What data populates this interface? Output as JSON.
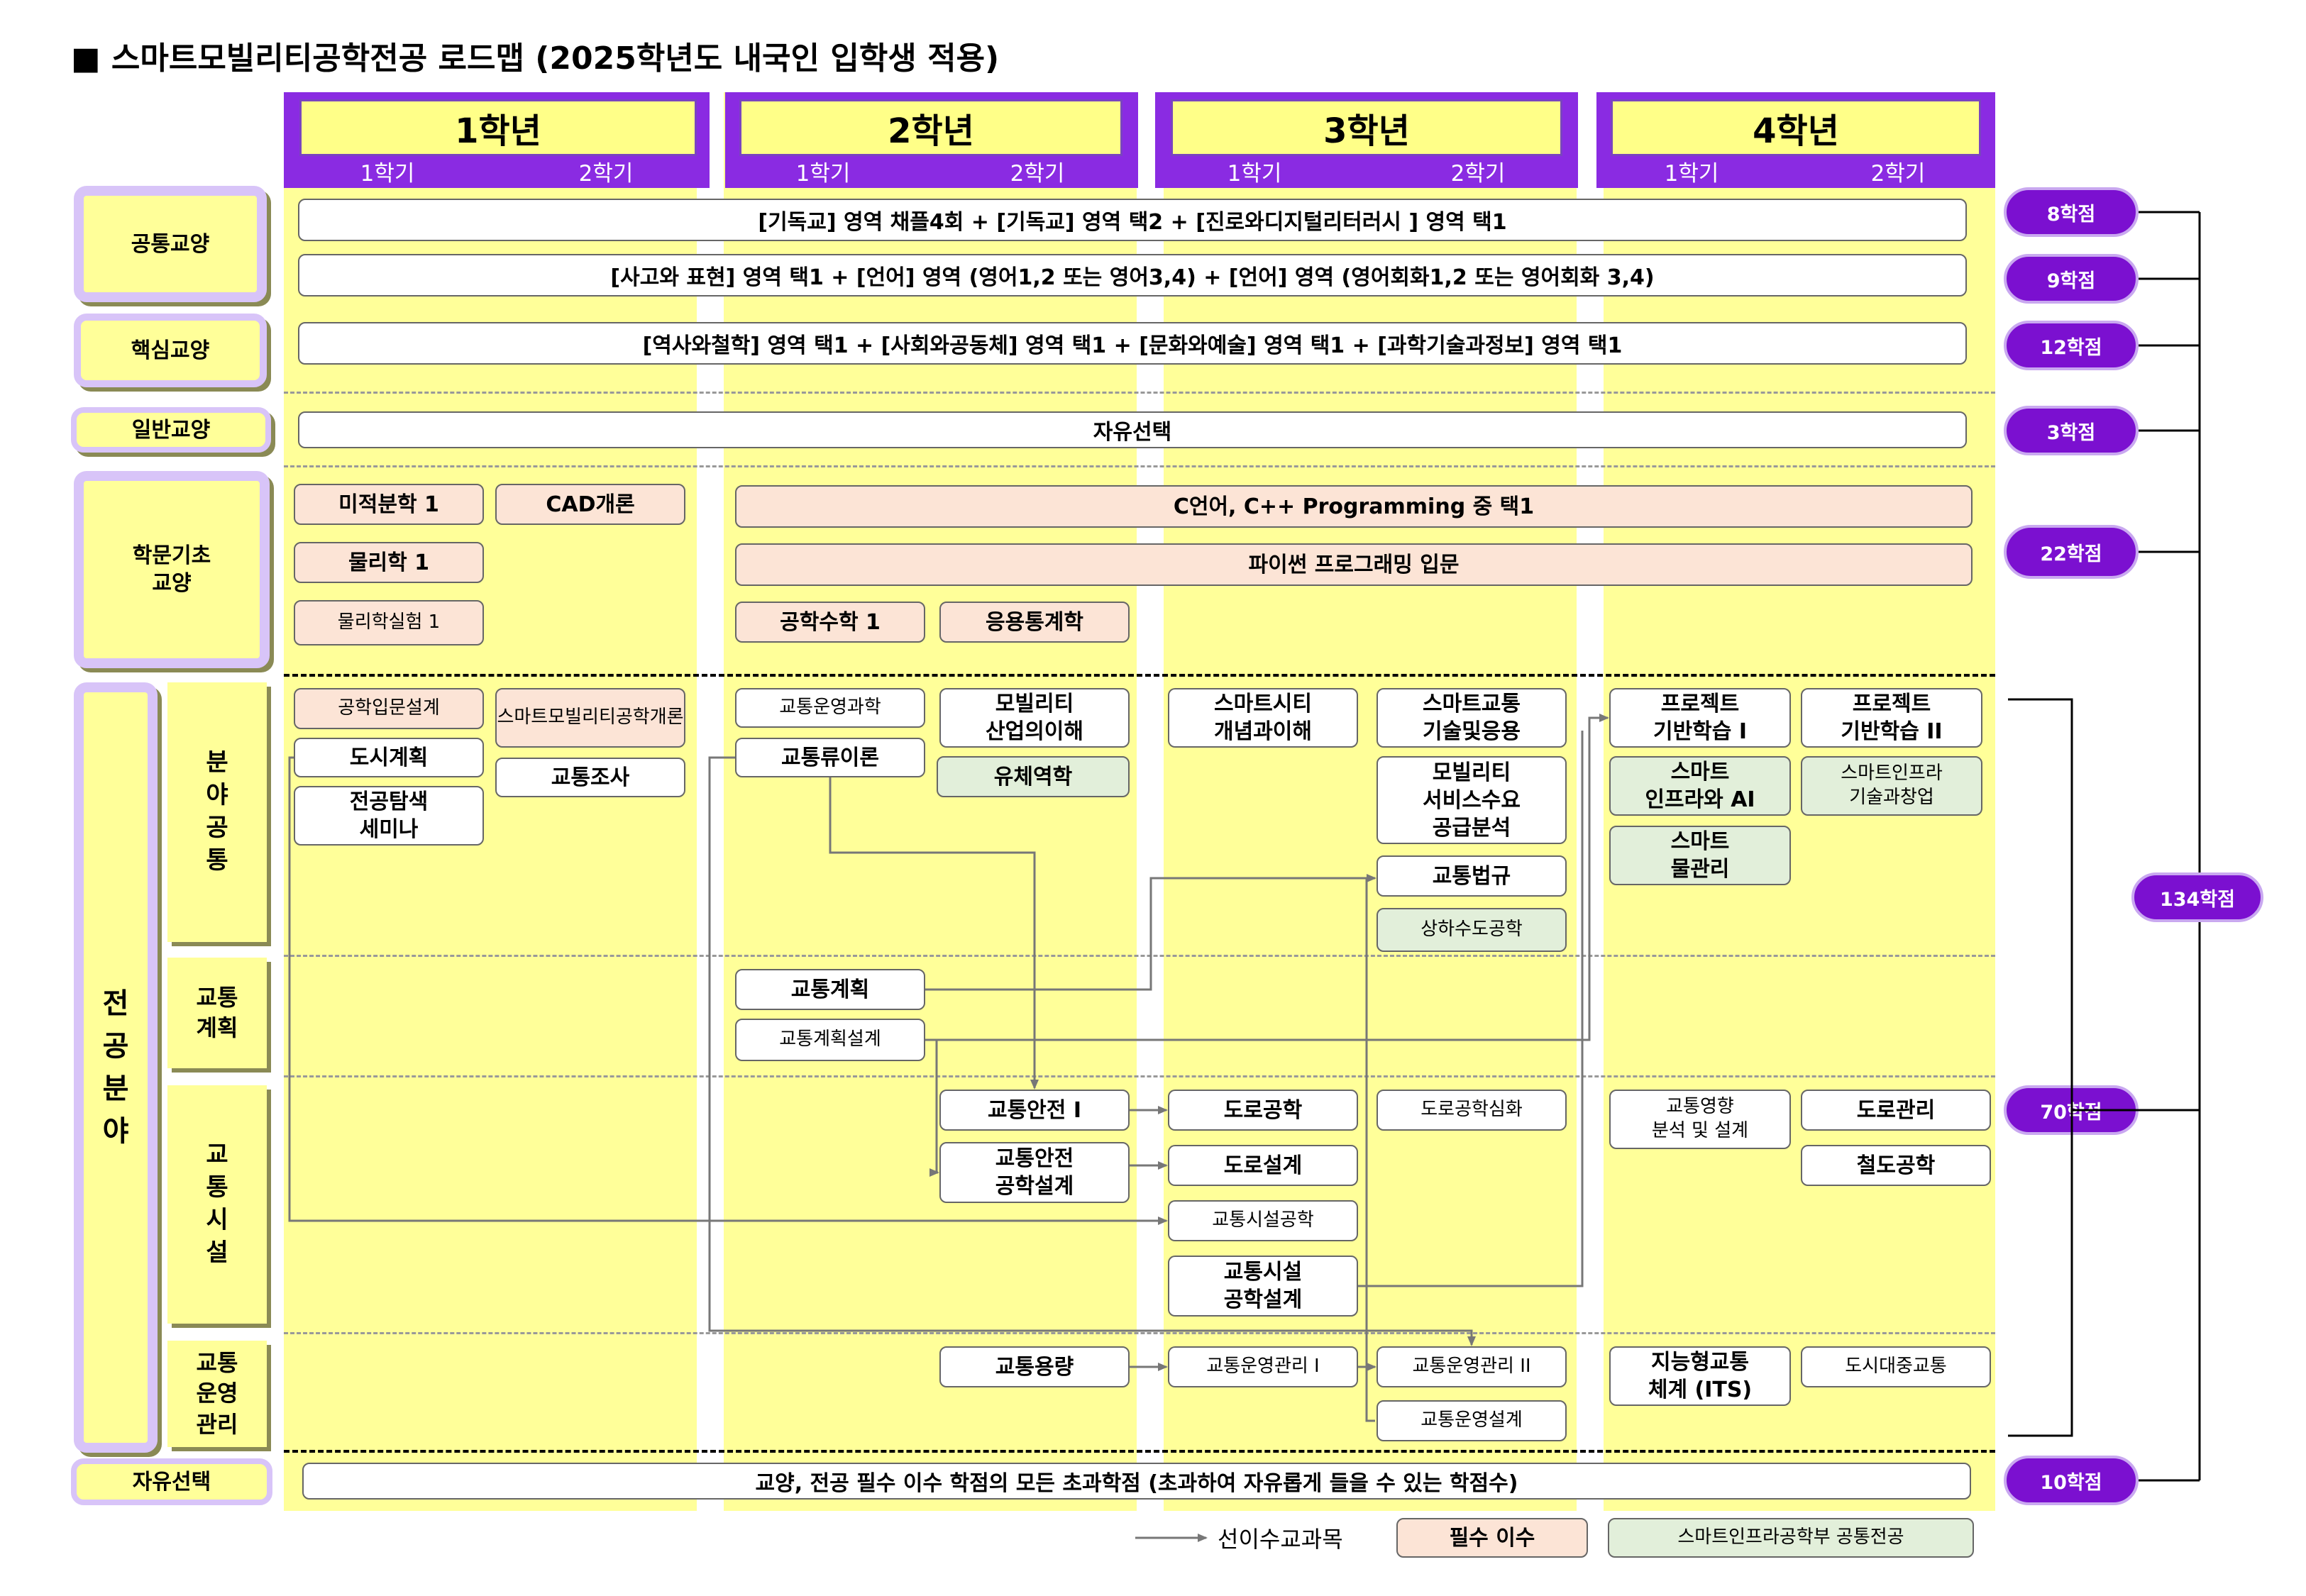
{
  "title": "■ 스마트모빌리티공학전공   로드맵 (2025학년도 내국인 입학생 적용)",
  "years": [
    {
      "label": "1학년",
      "sem1": "1학기",
      "sem2": "2학기"
    },
    {
      "label": "2학년",
      "sem1": "1학기",
      "sem2": "2학기"
    },
    {
      "label": "3학년",
      "sem1": "1학기",
      "sem2": "2학기"
    },
    {
      "label": "4학년",
      "sem1": "1학기",
      "sem2": "2학기"
    }
  ],
  "categories": {
    "common": "공통교양",
    "core": "핵심교양",
    "general": "일반교양",
    "foundation": "학문기초\n교양",
    "major": "전\n공\n분\n야",
    "major_common": "분\n야\n공\n통",
    "traffic_plan": "교통\n계획",
    "traffic_facility": "교\n통\n시\n설",
    "traffic_ops": "교통\n운영\n관리",
    "free": "자유선택"
  },
  "rows": {
    "common1": "[기독교] 영역 채플4회 + [기독교] 영역 택2 + [진로와디지털리터러시 ] 영역 택1",
    "common2": "[사고와 표현] 영역 택1 + [언어] 영역 (영어1,2 또는 영어3,4) + [언어] 영역 (영어회화1,2 또는 영어회화 3,4)",
    "core": "[역사와철학] 영역 택1 + [사회와공동체] 영역 택1 + [문화와예술] 영역 택1 + [과학기술과정보] 영역 택1",
    "general": "자유선택",
    "free": "교양, 전공 필수 이수 학점의 모든 초과학점 (초과하여 자유롭게 들을 수 있는 학점수)"
  },
  "courses": {
    "calc": "미적분학 1",
    "cad": "CAD개론",
    "physics": "물리학 1",
    "physlab": "물리학실험 1",
    "clang": "C언어, C++ Programming 중 택1",
    "python": "파이썬 프로그래밍 입문",
    "engmath": "공학수학 1",
    "stats": "응용통계학",
    "intro_design": "공학입문설계",
    "intro_smart": "스마트모빌리티공학개론",
    "urban_plan": "도시계획",
    "seminar": "전공탐색\n세미나",
    "survey": "교통조사",
    "traffic_ops_sci": "교통운영과학",
    "flow_theory": "교통류이론",
    "mobility_industry": "모빌리티\n산업의이해",
    "fluid": "유체역학",
    "smart_city": "스마트시티\n개념과이해",
    "smart_traffic": "스마트교통\n기술및응용",
    "mobility_demand": "모빌리티\n서비스수요\n공급분석",
    "traffic_law": "교통법규",
    "water": "상하수도공학",
    "project1": "프로젝트\n기반학습 I",
    "project2": "프로젝트\n기반학습 II",
    "smart_infra_ai": "스마트\n인프라와 AI",
    "smart_infra_tech": "스마트인프라\n기술과창업",
    "smart_water": "스마트\n물관리",
    "traffic_planning": "교통계획",
    "traffic_plan_design": "교통계획설계",
    "safety1": "교통안전 I",
    "safety_design": "교통안전\n공학설계",
    "road_eng": "도로공학",
    "road_design": "도로설계",
    "facility_eng": "교통시설공학",
    "facility_design": "교통시설\n공학설계",
    "road_adv": "도로공학심화",
    "impact": "교통영향\n분석 및 설계",
    "road_mgmt": "도로관리",
    "rail": "철도공학",
    "capacity": "교통용량",
    "ops1": "교통운영관리 I",
    "ops2": "교통운영관리 II",
    "ops_design": "교통운영설계",
    "its": "지능형교통\n체계 (ITS)",
    "transit": "도시대중교통"
  },
  "credits": {
    "common1": "8학점",
    "common2": "9학점",
    "core": "12학점",
    "general": "3학점",
    "foundation": "22학점",
    "major": "70학점",
    "free": "10학점",
    "total": "134학점"
  },
  "legend": {
    "prereq": "선이수교과목",
    "required": "필수 이수",
    "common_major": "스마트인프라공학부 공통전공"
  },
  "colors": {
    "purple": "#8a2be2",
    "yellow": "#ffff99",
    "required": "#fce4d6",
    "common_major": "#e2efda"
  }
}
